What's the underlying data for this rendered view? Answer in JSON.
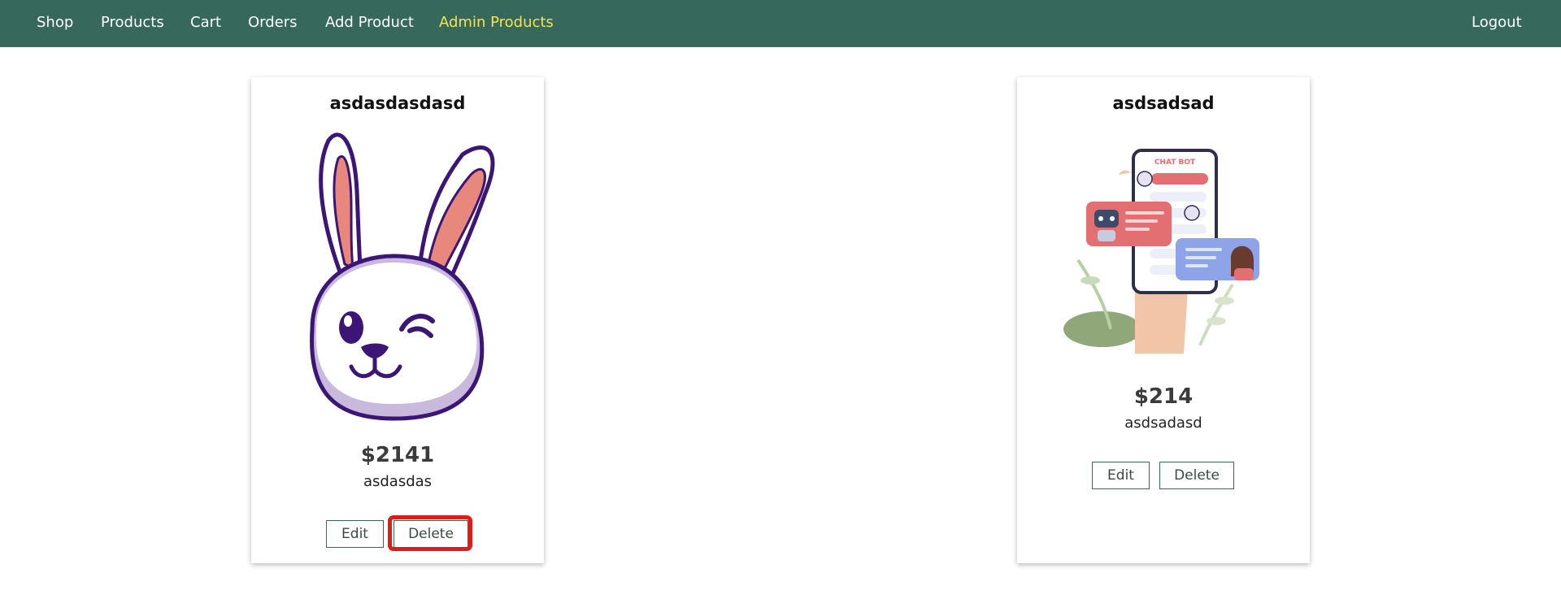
{
  "nav": {
    "shop": "Shop",
    "products": "Products",
    "cart": "Cart",
    "orders": "Orders",
    "add_product": "Add Product",
    "admin_products": "Admin Products",
    "logout": "Logout",
    "active": "admin_products",
    "bar_color": "#36695b",
    "active_color": "#f4e451"
  },
  "products": [
    {
      "title": "asdasdasdasd",
      "price": "$2141",
      "description": "asdasdas",
      "image": "bunny-winking-illustration",
      "edit_label": "Edit",
      "delete_label": "Delete"
    },
    {
      "title": "asdsadsad",
      "price": "$214",
      "description": "asdsadasd",
      "image": "chat-bot-phone-illustration",
      "image_text": "CHAT BOT",
      "edit_label": "Edit",
      "delete_label": "Delete"
    }
  ],
  "annotation": {
    "highlighted": "products.0.delete_label",
    "color": "#e01b1b"
  }
}
